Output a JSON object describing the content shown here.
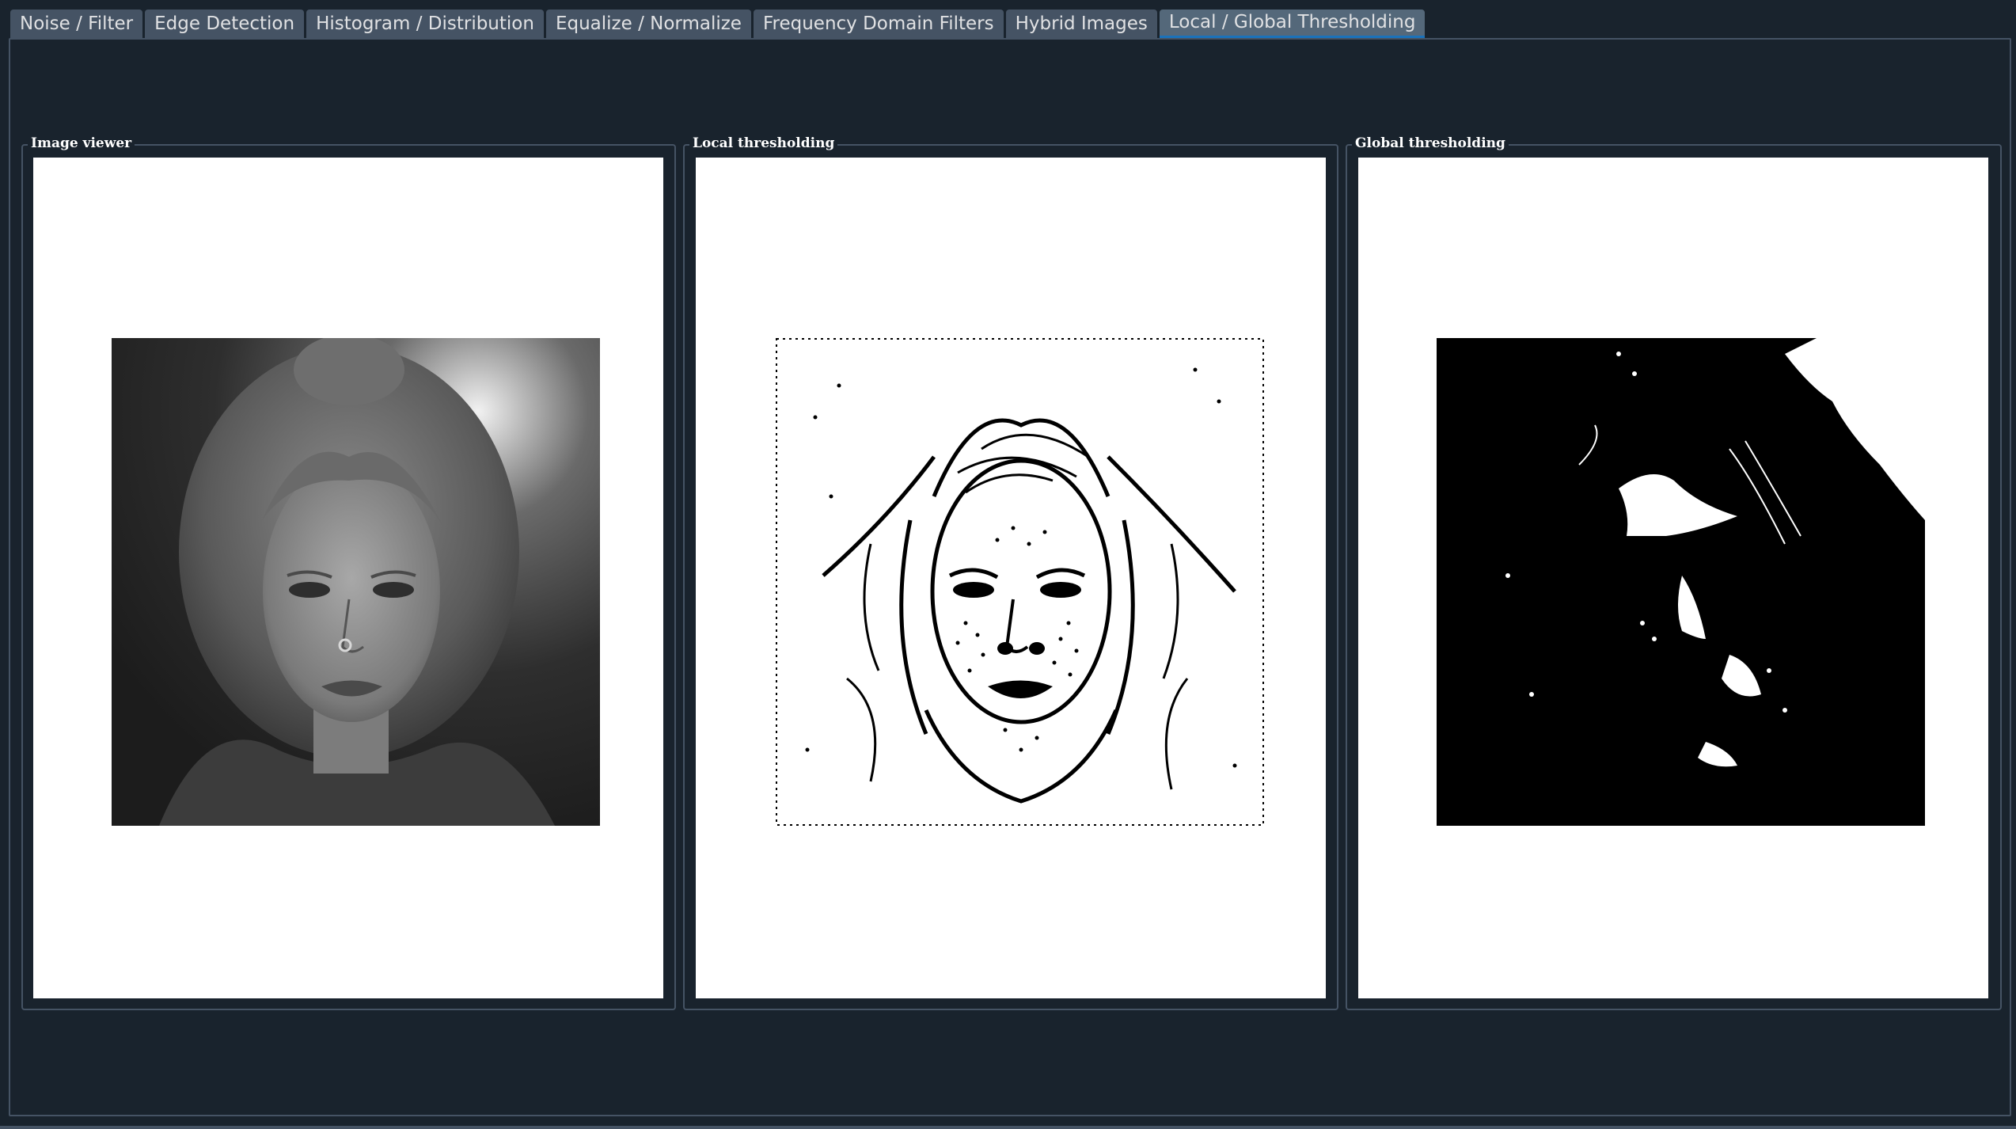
{
  "tabs": [
    {
      "label": "Noise / Filter",
      "active": false
    },
    {
      "label": "Edge Detection",
      "active": false
    },
    {
      "label": "Histogram / Distribution",
      "active": false
    },
    {
      "label": "Equalize / Normalize",
      "active": false
    },
    {
      "label": "Frequency Domain Filters",
      "active": false
    },
    {
      "label": "Hybrid Images",
      "active": false
    },
    {
      "label": "Local / Global Thresholding",
      "active": true
    }
  ],
  "panels": {
    "original": {
      "title": "Image viewer"
    },
    "local": {
      "title": "Local thresholding"
    },
    "global": {
      "title": "Global thresholding"
    }
  },
  "colors": {
    "background": "#19232d",
    "tab": "#455364",
    "tab_active": "#54687a",
    "tab_indicator": "#1a72bb",
    "canvas": "#ffffff"
  }
}
